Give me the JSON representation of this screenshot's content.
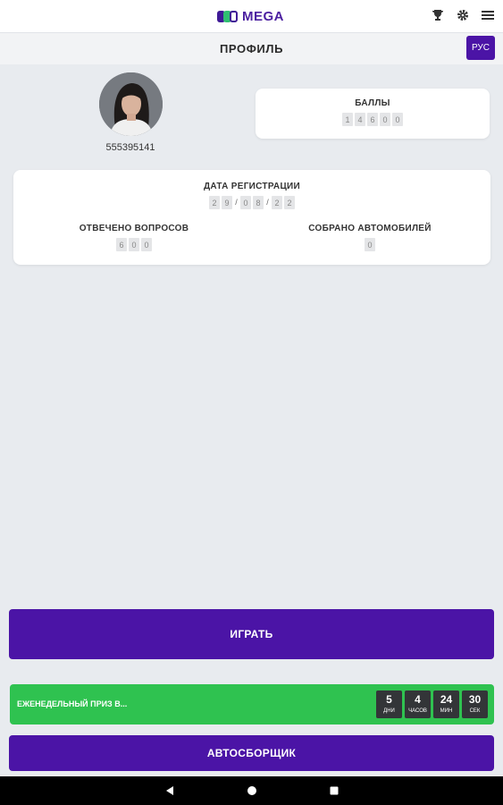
{
  "app": {
    "brand": "MEGA",
    "brand_colors": [
      "#3f1a96",
      "#2fbf71",
      "#4b1fa0"
    ]
  },
  "header": {
    "icons": [
      "trophy-icon",
      "gear-icon",
      "menu-icon"
    ]
  },
  "title_bar": {
    "title": "ПРОФИЛЬ",
    "lang_label": "РУС"
  },
  "profile": {
    "user_id": "555395141"
  },
  "points": {
    "label": "БАЛЛЫ",
    "digits": [
      "1",
      "4",
      "6",
      "0",
      "0"
    ]
  },
  "stats": {
    "registration_label": "ДАТА РЕГИСТРАЦИИ",
    "registration_date": [
      "2",
      "9",
      "0",
      "8",
      "2",
      "2"
    ],
    "date_separator": "/",
    "answered_label": "ОТВЕЧЕНО ВОПРОСОВ",
    "answered_digits": [
      "6",
      "0",
      "0"
    ],
    "cars_label": "СОБРАНО АВТОМОБИЛЕЙ",
    "cars_digits": [
      "0"
    ]
  },
  "actions": {
    "play_label": "ИГРАТЬ",
    "assembler_label": "АВТОСБОРЩИК"
  },
  "prize": {
    "text": "ЕЖЕНЕДЕЛЬНЫЙ ПРИЗ В...",
    "timer": [
      {
        "value": "5",
        "unit": "ДНИ"
      },
      {
        "value": "4",
        "unit": "ЧАСОВ"
      },
      {
        "value": "24",
        "unit": "МИН"
      },
      {
        "value": "30",
        "unit": "СЕК"
      }
    ]
  },
  "colors": {
    "accent": "#4b14a6",
    "prize_green": "#2fc250",
    "background": "#e8ebef"
  },
  "navbar": {
    "icons": [
      "back-icon",
      "home-icon",
      "recents-icon"
    ]
  }
}
